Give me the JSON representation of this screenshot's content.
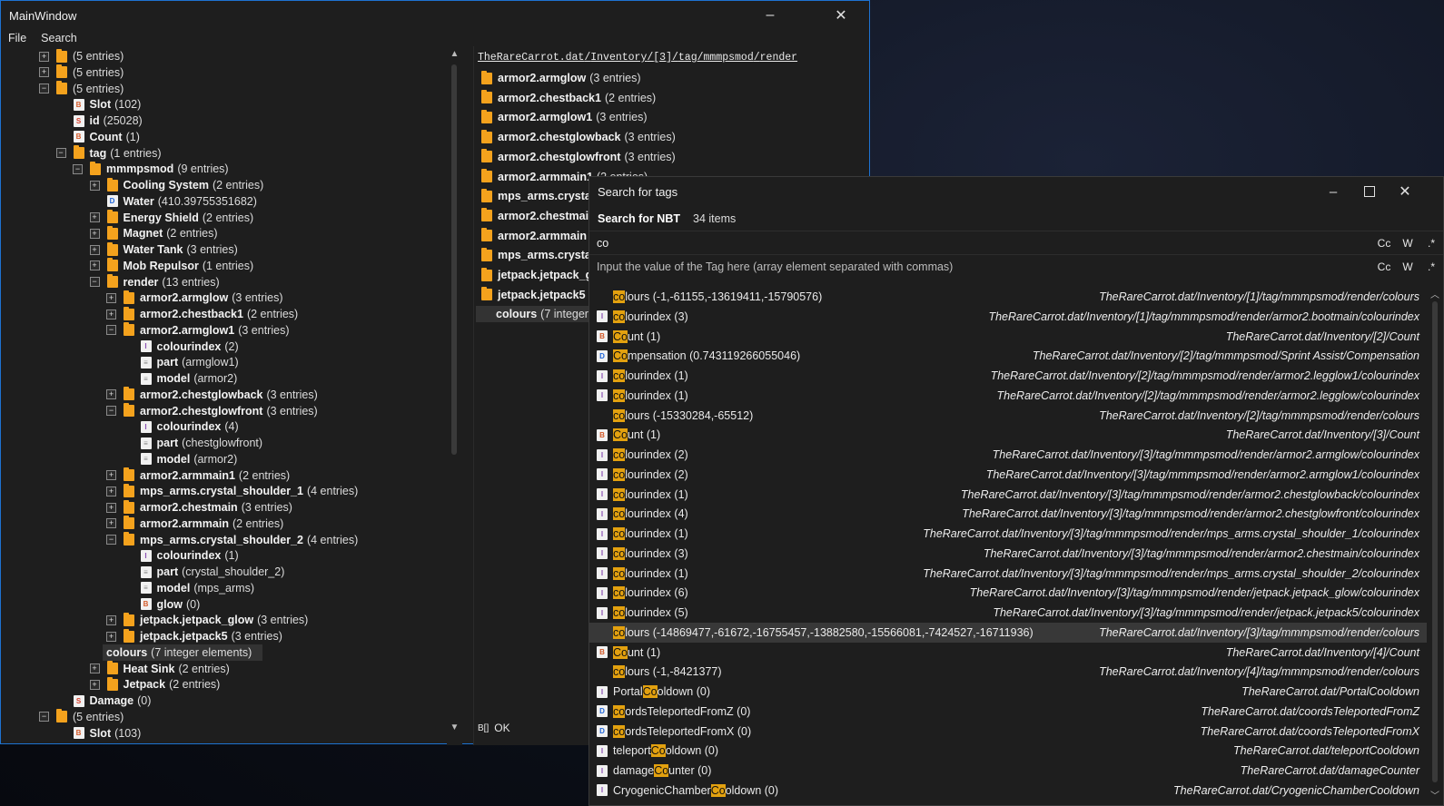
{
  "main_window": {
    "title": "MainWindow",
    "minimize": "–",
    "close": "✕",
    "menu": [
      "File",
      "Search"
    ]
  },
  "tree": [
    {
      "depth": 0,
      "exp": "+",
      "icon": "folder",
      "name": "",
      "value": "(5 entries)"
    },
    {
      "depth": 0,
      "exp": "+",
      "icon": "folder",
      "name": "",
      "value": "(5 entries)"
    },
    {
      "depth": 0,
      "exp": "−",
      "icon": "folder",
      "name": "",
      "value": "(5 entries)"
    },
    {
      "depth": 1,
      "exp": "",
      "icon": "b",
      "name": "Slot",
      "value": "(102)"
    },
    {
      "depth": 1,
      "exp": "",
      "icon": "s",
      "name": "id",
      "value": "(25028)"
    },
    {
      "depth": 1,
      "exp": "",
      "icon": "b",
      "name": "Count",
      "value": "(1)"
    },
    {
      "depth": 1,
      "exp": "−",
      "icon": "folder",
      "name": "tag",
      "value": "(1 entries)"
    },
    {
      "depth": 2,
      "exp": "−",
      "icon": "folder",
      "name": "mmmpsmod",
      "value": "(9 entries)"
    },
    {
      "depth": 3,
      "exp": "+",
      "icon": "folder",
      "name": "Cooling System",
      "value": "(2 entries)"
    },
    {
      "depth": 3,
      "exp": "",
      "icon": "d",
      "name": "Water",
      "value": "(410.39755351682)"
    },
    {
      "depth": 3,
      "exp": "+",
      "icon": "folder",
      "name": "Energy Shield",
      "value": "(2 entries)"
    },
    {
      "depth": 3,
      "exp": "+",
      "icon": "folder",
      "name": "Magnet",
      "value": "(2 entries)"
    },
    {
      "depth": 3,
      "exp": "+",
      "icon": "folder",
      "name": "Water Tank",
      "value": "(3 entries)"
    },
    {
      "depth": 3,
      "exp": "+",
      "icon": "folder",
      "name": "Mob Repulsor",
      "value": "(1 entries)"
    },
    {
      "depth": 3,
      "exp": "−",
      "icon": "folder",
      "name": "render",
      "value": "(13 entries)"
    },
    {
      "depth": 4,
      "exp": "+",
      "icon": "folder",
      "name": "armor2.armglow",
      "value": "(3 entries)"
    },
    {
      "depth": 4,
      "exp": "+",
      "icon": "folder",
      "name": "armor2.chestback1",
      "value": "(2 entries)"
    },
    {
      "depth": 4,
      "exp": "−",
      "icon": "folder",
      "name": "armor2.armglow1",
      "value": "(3 entries)"
    },
    {
      "depth": 5,
      "exp": "",
      "icon": "i",
      "name": "colourindex",
      "value": "(2)"
    },
    {
      "depth": 5,
      "exp": "",
      "icon": "str",
      "name": "part",
      "value": "(armglow1)"
    },
    {
      "depth": 5,
      "exp": "",
      "icon": "str",
      "name": "model",
      "value": "(armor2)"
    },
    {
      "depth": 4,
      "exp": "+",
      "icon": "folder",
      "name": "armor2.chestglowback",
      "value": "(3 entries)"
    },
    {
      "depth": 4,
      "exp": "−",
      "icon": "folder",
      "name": "armor2.chestglowfront",
      "value": "(3 entries)"
    },
    {
      "depth": 5,
      "exp": "",
      "icon": "i",
      "name": "colourindex",
      "value": "(4)"
    },
    {
      "depth": 5,
      "exp": "",
      "icon": "str",
      "name": "part",
      "value": "(chestglowfront)"
    },
    {
      "depth": 5,
      "exp": "",
      "icon": "str",
      "name": "model",
      "value": "(armor2)"
    },
    {
      "depth": 4,
      "exp": "+",
      "icon": "folder",
      "name": "armor2.armmain1",
      "value": "(2 entries)"
    },
    {
      "depth": 4,
      "exp": "+",
      "icon": "folder",
      "name": "mps_arms.crystal_shoulder_1",
      "value": "(4 entries)"
    },
    {
      "depth": 4,
      "exp": "+",
      "icon": "folder",
      "name": "armor2.chestmain",
      "value": "(3 entries)"
    },
    {
      "depth": 4,
      "exp": "+",
      "icon": "folder",
      "name": "armor2.armmain",
      "value": "(2 entries)"
    },
    {
      "depth": 4,
      "exp": "−",
      "icon": "folder",
      "name": "mps_arms.crystal_shoulder_2",
      "value": "(4 entries)"
    },
    {
      "depth": 5,
      "exp": "",
      "icon": "i",
      "name": "colourindex",
      "value": "(1)"
    },
    {
      "depth": 5,
      "exp": "",
      "icon": "str",
      "name": "part",
      "value": "(crystal_shoulder_2)"
    },
    {
      "depth": 5,
      "exp": "",
      "icon": "str",
      "name": "model",
      "value": "(mps_arms)"
    },
    {
      "depth": 5,
      "exp": "",
      "icon": "b",
      "name": "glow",
      "value": "(0)"
    },
    {
      "depth": 4,
      "exp": "+",
      "icon": "folder",
      "name": "jetpack.jetpack_glow",
      "value": "(3 entries)"
    },
    {
      "depth": 4,
      "exp": "+",
      "icon": "folder",
      "name": "jetpack.jetpack5",
      "value": "(3 entries)"
    },
    {
      "depth": 4,
      "exp": "",
      "icon": "none",
      "name": "colours",
      "value": "(7 integer elements)",
      "selected": true
    },
    {
      "depth": 3,
      "exp": "+",
      "icon": "folder",
      "name": "Heat Sink",
      "value": "(2 entries)"
    },
    {
      "depth": 3,
      "exp": "+",
      "icon": "folder",
      "name": "Jetpack",
      "value": "(2 entries)"
    },
    {
      "depth": 1,
      "exp": "",
      "icon": "s",
      "name": "Damage",
      "value": "(0)"
    },
    {
      "depth": 0,
      "exp": "−",
      "icon": "folder",
      "name": "",
      "value": "(5 entries)"
    },
    {
      "depth": 1,
      "exp": "",
      "icon": "b",
      "name": "Slot",
      "value": "(103)"
    }
  ],
  "right_pane": {
    "breadcrumb": [
      "TheRareCarrot.dat",
      "Inventory",
      "[3]",
      "tag",
      "mmmpsmod",
      "render"
    ],
    "items": [
      {
        "name": "armor2.armglow",
        "value": "(3 entries)"
      },
      {
        "name": "armor2.chestback1",
        "value": "(2 entries)"
      },
      {
        "name": "armor2.armglow1",
        "value": "(3 entries)"
      },
      {
        "name": "armor2.chestglowback",
        "value": "(3 entries)"
      },
      {
        "name": "armor2.chestglowfront",
        "value": "(3 entries)"
      },
      {
        "name": "armor2.armmain1",
        "value": "(2 entries)"
      },
      {
        "name": "mps_arms.crystal",
        "value": ""
      },
      {
        "name": "armor2.chestmai",
        "value": ""
      },
      {
        "name": "armor2.armmain",
        "value": ""
      },
      {
        "name": "mps_arms.crystal",
        "value": ""
      },
      {
        "name": "jetpack.jetpack_g",
        "value": ""
      },
      {
        "name": "jetpack.jetpack5",
        "value": ""
      },
      {
        "name": "colours",
        "value": "(7 integer",
        "selected": true
      }
    ],
    "status_icon": "B[]",
    "status_text": "OK"
  },
  "search_window": {
    "title": "Search for tags",
    "tab_label": "Search for NBT",
    "count_label": "34 items",
    "query": "co",
    "value_placeholder": "Input the value of the Tag here (array element separated with commas)",
    "opts": [
      "Cc",
      "W",
      ".*"
    ],
    "results": [
      {
        "icon": "none",
        "pre": "",
        "hl": "co",
        "post": "lours (-1,-61155,-13619411,-15790576)",
        "path": "TheRareCarrot.dat/Inventory/[1]/tag/mmmpsmod/render/colours"
      },
      {
        "icon": "i",
        "pre": "",
        "hl": "co",
        "post": "lourindex (3)",
        "path": "TheRareCarrot.dat/Inventory/[1]/tag/mmmpsmod/render/armor2.bootmain/colourindex"
      },
      {
        "icon": "b",
        "pre": "",
        "hl": "Co",
        "post": "unt (1)",
        "path": "TheRareCarrot.dat/Inventory/[2]/Count"
      },
      {
        "icon": "d",
        "pre": "",
        "hl": "Co",
        "post": "mpensation (0.743119266055046)",
        "path": "TheRareCarrot.dat/Inventory/[2]/tag/mmmpsmod/Sprint Assist/Compensation"
      },
      {
        "icon": "i",
        "pre": "",
        "hl": "co",
        "post": "lourindex (1)",
        "path": "TheRareCarrot.dat/Inventory/[2]/tag/mmmpsmod/render/armor2.legglow1/colourindex"
      },
      {
        "icon": "i",
        "pre": "",
        "hl": "co",
        "post": "lourindex (1)",
        "path": "TheRareCarrot.dat/Inventory/[2]/tag/mmmpsmod/render/armor2.legglow/colourindex"
      },
      {
        "icon": "none",
        "pre": "",
        "hl": "co",
        "post": "lours (-15330284,-65512)",
        "path": "TheRareCarrot.dat/Inventory/[2]/tag/mmmpsmod/render/colours"
      },
      {
        "icon": "b",
        "pre": "",
        "hl": "Co",
        "post": "unt (1)",
        "path": "TheRareCarrot.dat/Inventory/[3]/Count"
      },
      {
        "icon": "i",
        "pre": "",
        "hl": "co",
        "post": "lourindex (2)",
        "path": "TheRareCarrot.dat/Inventory/[3]/tag/mmmpsmod/render/armor2.armglow/colourindex"
      },
      {
        "icon": "i",
        "pre": "",
        "hl": "co",
        "post": "lourindex (2)",
        "path": "TheRareCarrot.dat/Inventory/[3]/tag/mmmpsmod/render/armor2.armglow1/colourindex"
      },
      {
        "icon": "i",
        "pre": "",
        "hl": "co",
        "post": "lourindex (1)",
        "path": "TheRareCarrot.dat/Inventory/[3]/tag/mmmpsmod/render/armor2.chestglowback/colourindex"
      },
      {
        "icon": "i",
        "pre": "",
        "hl": "co",
        "post": "lourindex (4)",
        "path": "TheRareCarrot.dat/Inventory/[3]/tag/mmmpsmod/render/armor2.chestglowfront/colourindex"
      },
      {
        "icon": "i",
        "pre": "",
        "hl": "co",
        "post": "lourindex (1)",
        "path": "TheRareCarrot.dat/Inventory/[3]/tag/mmmpsmod/render/mps_arms.crystal_shoulder_1/colourindex"
      },
      {
        "icon": "i",
        "pre": "",
        "hl": "co",
        "post": "lourindex (3)",
        "path": "TheRareCarrot.dat/Inventory/[3]/tag/mmmpsmod/render/armor2.chestmain/colourindex"
      },
      {
        "icon": "i",
        "pre": "",
        "hl": "co",
        "post": "lourindex (1)",
        "path": "TheRareCarrot.dat/Inventory/[3]/tag/mmmpsmod/render/mps_arms.crystal_shoulder_2/colourindex"
      },
      {
        "icon": "i",
        "pre": "",
        "hl": "co",
        "post": "lourindex (6)",
        "path": "TheRareCarrot.dat/Inventory/[3]/tag/mmmpsmod/render/jetpack.jetpack_glow/colourindex"
      },
      {
        "icon": "i",
        "pre": "",
        "hl": "co",
        "post": "lourindex (5)",
        "path": "TheRareCarrot.dat/Inventory/[3]/tag/mmmpsmod/render/jetpack.jetpack5/colourindex"
      },
      {
        "icon": "none",
        "pre": "",
        "hl": "co",
        "post": "lours (-14869477,-61672,-16755457,-13882580,-15566081,-7424527,-16711936)",
        "path": "TheRareCarrot.dat/Inventory/[3]/tag/mmmpsmod/render/colours",
        "selected": true
      },
      {
        "icon": "b",
        "pre": "",
        "hl": "Co",
        "post": "unt (1)",
        "path": "TheRareCarrot.dat/Inventory/[4]/Count"
      },
      {
        "icon": "none",
        "pre": "",
        "hl": "co",
        "post": "lours (-1,-8421377)",
        "path": "TheRareCarrot.dat/Inventory/[4]/tag/mmmpsmod/render/colours"
      },
      {
        "icon": "i",
        "pre": "Portal",
        "hl": "Co",
        "post": "oldown (0)",
        "path": "TheRareCarrot.dat/PortalCooldown"
      },
      {
        "icon": "d",
        "pre": "",
        "hl": "co",
        "post": "ordsTeleportedFromZ (0)",
        "path": "TheRareCarrot.dat/coordsTeleportedFromZ"
      },
      {
        "icon": "d",
        "pre": "",
        "hl": "co",
        "post": "ordsTeleportedFromX (0)",
        "path": "TheRareCarrot.dat/coordsTeleportedFromX"
      },
      {
        "icon": "i",
        "pre": "teleport",
        "hl": "Co",
        "post": "oldown (0)",
        "path": "TheRareCarrot.dat/teleportCooldown"
      },
      {
        "icon": "i",
        "pre": "damage",
        "hl": "Co",
        "post": "unter (0)",
        "path": "TheRareCarrot.dat/damageCounter"
      },
      {
        "icon": "i",
        "pre": "CryogenicChamber",
        "hl": "Co",
        "post": "oldown (0)",
        "path": "TheRareCarrot.dat/CryogenicChamberCooldown"
      }
    ]
  },
  "colors": {
    "accent": "#1e73d1",
    "folder": "#f4a21d",
    "highlight": "#e3a10f",
    "background": "#1e1e1e"
  }
}
